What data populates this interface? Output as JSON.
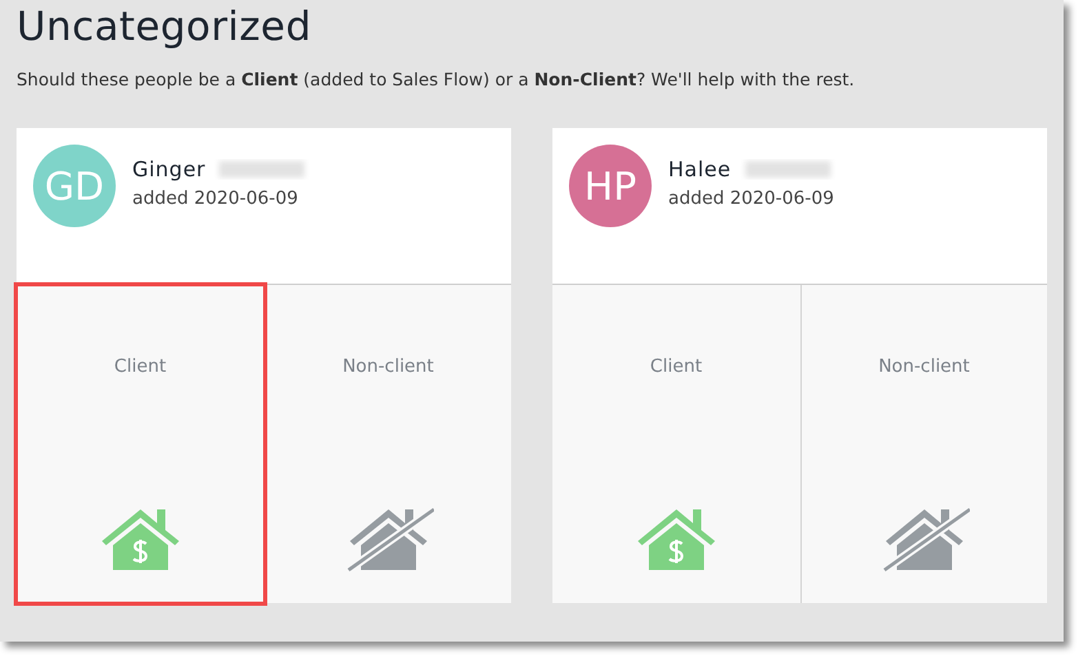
{
  "title": "Uncategorized",
  "prompt": "Should these people be a **Client** (added to Sales Flow) or a **Non-Client**? We'll help with the rest.",
  "people": [
    {
      "initials": "GD",
      "color": "#7fd4c9",
      "first_name": "Ginger",
      "added": "added 2020-06-09",
      "options": [
        {
          "label": "Client",
          "kind": "client",
          "highlighted": true
        },
        {
          "label": "Non-client",
          "kind": "nonclient",
          "highlighted": false
        }
      ]
    },
    {
      "initials": "HP",
      "color": "#d67095",
      "first_name": "Halee",
      "added": "added 2020-06-09",
      "options": [
        {
          "label": "Client",
          "kind": "client",
          "highlighted": false
        },
        {
          "label": "Non-client",
          "kind": "nonclient",
          "highlighted": false
        }
      ]
    }
  ]
}
